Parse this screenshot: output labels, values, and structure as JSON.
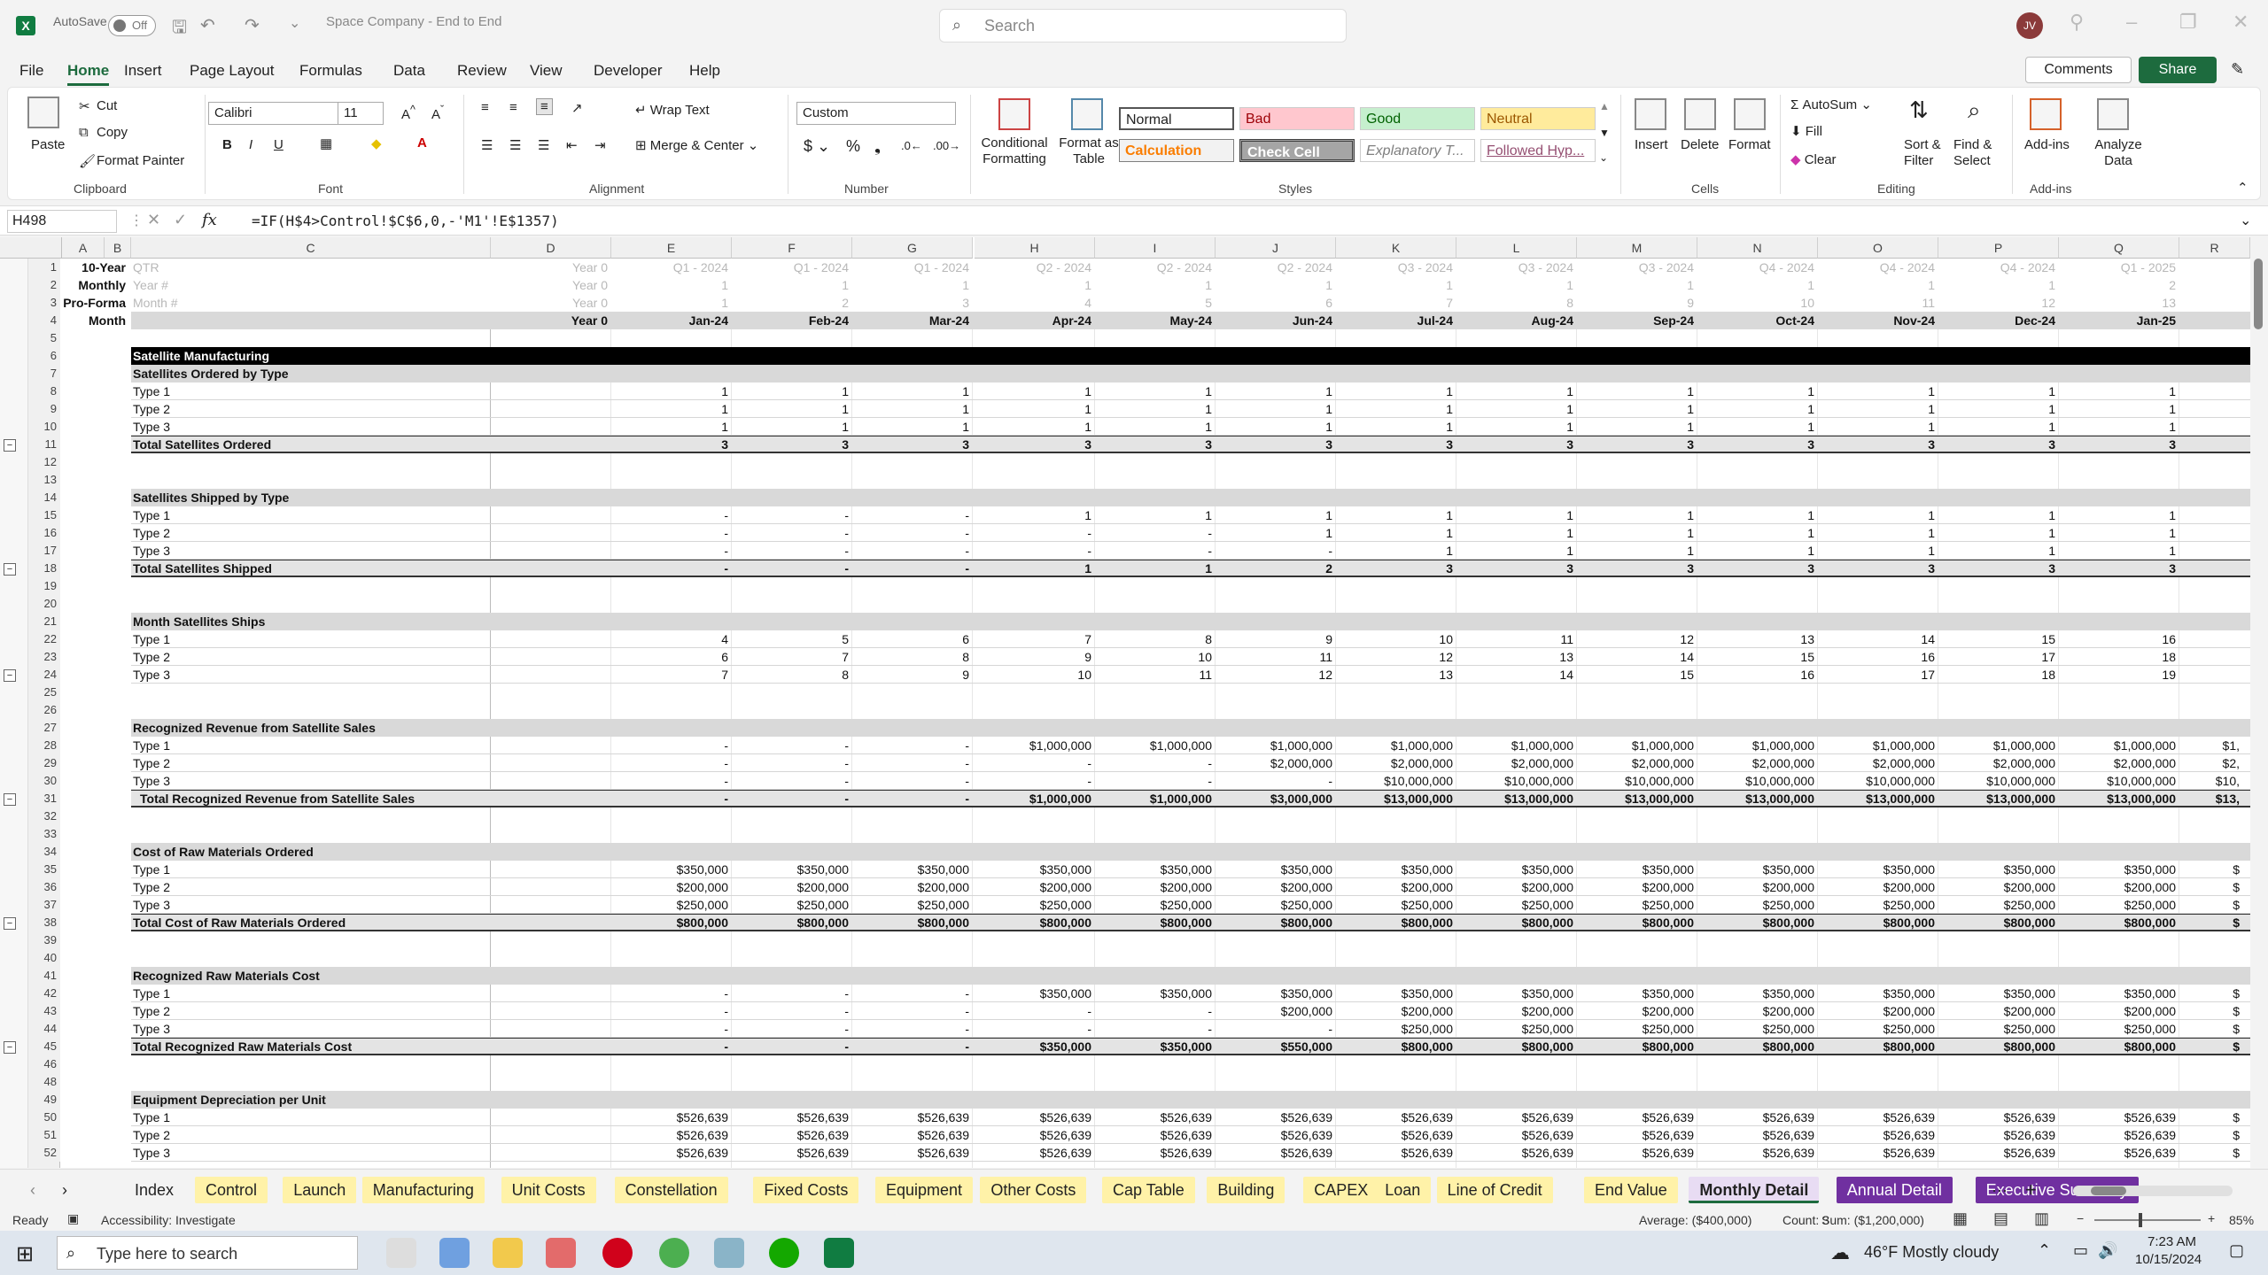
{
  "app": {
    "autosave_label": "AutoSave",
    "autosave_state": "Off",
    "doc_title": "Space Company - End to End",
    "search_placeholder": "Search",
    "avatar": "JV"
  },
  "menu": [
    "File",
    "Home",
    "Insert",
    "Page Layout",
    "Formulas",
    "Data",
    "Review",
    "View",
    "Developer",
    "Help"
  ],
  "menu_active": "Home",
  "comments": "Comments",
  "share": "Share",
  "ribbon": {
    "clipboard": {
      "paste": "Paste",
      "cut": "Cut",
      "copy": "Copy",
      "format_painter": "Format Painter",
      "group": "Clipboard"
    },
    "font": {
      "family": "Calibri",
      "size": "11",
      "group": "Font"
    },
    "alignment": {
      "wrap": "Wrap Text",
      "merge": "Merge & Center",
      "group": "Alignment"
    },
    "number": {
      "format": "Custom",
      "group": "Number"
    },
    "styles": {
      "cond": "Conditional Formatting",
      "fmt_table": "Format as Table",
      "normal": "Normal",
      "bad": "Bad",
      "good": "Good",
      "neutral": "Neutral",
      "calculation": "Calculation",
      "check": "Check Cell",
      "explanatory": "Explanatory T...",
      "followed": "Followed Hyp...",
      "group": "Styles"
    },
    "cells": {
      "insert": "Insert",
      "delete": "Delete",
      "format": "Format",
      "group": "Cells"
    },
    "editing": {
      "autosum": "AutoSum",
      "fill": "Fill",
      "clear": "Clear",
      "sort": "Sort & Filter",
      "find": "Find & Select",
      "group": "Editing"
    },
    "addins": {
      "addins": "Add-ins",
      "analyze": "Analyze Data",
      "group": "Add-ins"
    }
  },
  "namebox": "H498",
  "formula": "=IF(H$4>Control!$C$6,0,-'M1'!E$1357)",
  "columns": [
    "A",
    "B",
    "C",
    "D",
    "E",
    "F",
    "G",
    "H",
    "I",
    "J",
    "K",
    "L",
    "M",
    "N",
    "O",
    "P",
    "Q",
    "R"
  ],
  "header_rows": {
    "row1": {
      "label": "10-Year",
      "sub": "QTR",
      "year0": "Year 0",
      "vals": [
        "Q1 - 2024",
        "Q1 - 2024",
        "Q1 - 2024",
        "Q2 - 2024",
        "Q2 - 2024",
        "Q2 - 2024",
        "Q3 - 2024",
        "Q3 - 2024",
        "Q3 - 2024",
        "Q4 - 2024",
        "Q4 - 2024",
        "Q4 - 2024",
        "Q1 - 2025"
      ]
    },
    "row2": {
      "label": "Monthly",
      "sub": "Year #",
      "year0": "Year 0",
      "vals": [
        "1",
        "1",
        "1",
        "1",
        "1",
        "1",
        "1",
        "1",
        "1",
        "1",
        "1",
        "1",
        "2"
      ]
    },
    "row3": {
      "label": "Pro-Forma",
      "sub": "Month #",
      "year0": "Year 0",
      "vals": [
        "1",
        "2",
        "3",
        "4",
        "5",
        "6",
        "7",
        "8",
        "9",
        "10",
        "11",
        "12",
        "13"
      ]
    },
    "row4": {
      "label": "Month",
      "year0": "Year 0",
      "vals": [
        "Jan-24",
        "Feb-24",
        "Mar-24",
        "Apr-24",
        "May-24",
        "Jun-24",
        "Jul-24",
        "Aug-24",
        "Sep-24",
        "Oct-24",
        "Nov-24",
        "Dec-24",
        "Jan-25"
      ]
    }
  },
  "rows": [
    {
      "r": "5"
    },
    {
      "r": "6",
      "label": "Satellite Manufacturing",
      "kind": "banner"
    },
    {
      "r": "7",
      "label": "Satellites Ordered by Type",
      "kind": "section"
    },
    {
      "r": "8",
      "label": "Type 1",
      "vals": [
        "1",
        "1",
        "1",
        "1",
        "1",
        "1",
        "1",
        "1",
        "1",
        "1",
        "1",
        "1",
        "1"
      ]
    },
    {
      "r": "9",
      "label": "Type 2",
      "vals": [
        "1",
        "1",
        "1",
        "1",
        "1",
        "1",
        "1",
        "1",
        "1",
        "1",
        "1",
        "1",
        "1"
      ]
    },
    {
      "r": "10",
      "label": "Type 3",
      "vals": [
        "1",
        "1",
        "1",
        "1",
        "1",
        "1",
        "1",
        "1",
        "1",
        "1",
        "1",
        "1",
        "1"
      ]
    },
    {
      "r": "11",
      "label": "Total Satellites Ordered",
      "kind": "total",
      "vals": [
        "3",
        "3",
        "3",
        "3",
        "3",
        "3",
        "3",
        "3",
        "3",
        "3",
        "3",
        "3",
        "3"
      ]
    },
    {
      "r": "12"
    },
    {
      "r": "13"
    },
    {
      "r": "14",
      "label": "Satellites Shipped by Type",
      "kind": "section"
    },
    {
      "r": "15",
      "label": "Type 1",
      "vals": [
        "-",
        "-",
        "-",
        "1",
        "1",
        "1",
        "1",
        "1",
        "1",
        "1",
        "1",
        "1",
        "1"
      ]
    },
    {
      "r": "16",
      "label": "Type 2",
      "vals": [
        "-",
        "-",
        "-",
        "-",
        "-",
        "1",
        "1",
        "1",
        "1",
        "1",
        "1",
        "1",
        "1"
      ]
    },
    {
      "r": "17",
      "label": "Type 3",
      "vals": [
        "-",
        "-",
        "-",
        "-",
        "-",
        "-",
        "1",
        "1",
        "1",
        "1",
        "1",
        "1",
        "1"
      ]
    },
    {
      "r": "18",
      "label": "Total Satellites Shipped",
      "kind": "total",
      "vals": [
        "-",
        "-",
        "-",
        "1",
        "1",
        "2",
        "3",
        "3",
        "3",
        "3",
        "3",
        "3",
        "3"
      ]
    },
    {
      "r": "19"
    },
    {
      "r": "20"
    },
    {
      "r": "21",
      "label": "Month Satellites Ships",
      "kind": "section"
    },
    {
      "r": "22",
      "label": "Type 1",
      "vals": [
        "4",
        "5",
        "6",
        "7",
        "8",
        "9",
        "10",
        "11",
        "12",
        "13",
        "14",
        "15",
        "16"
      ]
    },
    {
      "r": "23",
      "label": "Type 2",
      "vals": [
        "6",
        "7",
        "8",
        "9",
        "10",
        "11",
        "12",
        "13",
        "14",
        "15",
        "16",
        "17",
        "18"
      ]
    },
    {
      "r": "24",
      "label": "Type 3",
      "vals": [
        "7",
        "8",
        "9",
        "10",
        "11",
        "12",
        "13",
        "14",
        "15",
        "16",
        "17",
        "18",
        "19"
      ]
    },
    {
      "r": "25"
    },
    {
      "r": "26"
    },
    {
      "r": "27",
      "label": "Recognized Revenue from Satellite Sales",
      "kind": "section"
    },
    {
      "r": "28",
      "label": "Type 1",
      "vals": [
        "-",
        "-",
        "-",
        "$1,000,000",
        "$1,000,000",
        "$1,000,000",
        "$1,000,000",
        "$1,000,000",
        "$1,000,000",
        "$1,000,000",
        "$1,000,000",
        "$1,000,000",
        "$1,000,000"
      ],
      "extra": "$1,"
    },
    {
      "r": "29",
      "label": "Type 2",
      "vals": [
        "-",
        "-",
        "-",
        "-",
        "-",
        "$2,000,000",
        "$2,000,000",
        "$2,000,000",
        "$2,000,000",
        "$2,000,000",
        "$2,000,000",
        "$2,000,000",
        "$2,000,000"
      ],
      "extra": "$2,"
    },
    {
      "r": "30",
      "label": "Type 3",
      "vals": [
        "-",
        "-",
        "-",
        "-",
        "-",
        "-",
        "$10,000,000",
        "$10,000,000",
        "$10,000,000",
        "$10,000,000",
        "$10,000,000",
        "$10,000,000",
        "$10,000,000"
      ],
      "extra": "$10,"
    },
    {
      "r": "31",
      "label": "Total Recognized Revenue from Satellite Sales",
      "kind": "total",
      "indent": true,
      "vals": [
        "-",
        "-",
        "-",
        "$1,000,000",
        "$1,000,000",
        "$3,000,000",
        "$13,000,000",
        "$13,000,000",
        "$13,000,000",
        "$13,000,000",
        "$13,000,000",
        "$13,000,000",
        "$13,000,000"
      ],
      "extra": "$13,"
    },
    {
      "r": "32"
    },
    {
      "r": "33"
    },
    {
      "r": "34",
      "label": "Cost of Raw Materials Ordered",
      "kind": "section"
    },
    {
      "r": "35",
      "label": "Type 1",
      "vals": [
        "$350,000",
        "$350,000",
        "$350,000",
        "$350,000",
        "$350,000",
        "$350,000",
        "$350,000",
        "$350,000",
        "$350,000",
        "$350,000",
        "$350,000",
        "$350,000",
        "$350,000"
      ],
      "extra": "$"
    },
    {
      "r": "36",
      "label": "Type 2",
      "vals": [
        "$200,000",
        "$200,000",
        "$200,000",
        "$200,000",
        "$200,000",
        "$200,000",
        "$200,000",
        "$200,000",
        "$200,000",
        "$200,000",
        "$200,000",
        "$200,000",
        "$200,000"
      ],
      "extra": "$"
    },
    {
      "r": "37",
      "label": "Type 3",
      "vals": [
        "$250,000",
        "$250,000",
        "$250,000",
        "$250,000",
        "$250,000",
        "$250,000",
        "$250,000",
        "$250,000",
        "$250,000",
        "$250,000",
        "$250,000",
        "$250,000",
        "$250,000"
      ],
      "extra": "$"
    },
    {
      "r": "38",
      "label": "Total Cost of Raw Materials Ordered",
      "kind": "total",
      "vals": [
        "$800,000",
        "$800,000",
        "$800,000",
        "$800,000",
        "$800,000",
        "$800,000",
        "$800,000",
        "$800,000",
        "$800,000",
        "$800,000",
        "$800,000",
        "$800,000",
        "$800,000"
      ],
      "extra": "$"
    },
    {
      "r": "39"
    },
    {
      "r": "40"
    },
    {
      "r": "41",
      "label": "Recognized Raw Materials Cost",
      "kind": "section"
    },
    {
      "r": "42",
      "label": "Type 1",
      "vals": [
        "-",
        "-",
        "-",
        "$350,000",
        "$350,000",
        "$350,000",
        "$350,000",
        "$350,000",
        "$350,000",
        "$350,000",
        "$350,000",
        "$350,000",
        "$350,000"
      ],
      "extra": "$"
    },
    {
      "r": "43",
      "label": "Type 2",
      "vals": [
        "-",
        "-",
        "-",
        "-",
        "-",
        "$200,000",
        "$200,000",
        "$200,000",
        "$200,000",
        "$200,000",
        "$200,000",
        "$200,000",
        "$200,000"
      ],
      "extra": "$"
    },
    {
      "r": "44",
      "label": "Type 3",
      "vals": [
        "-",
        "-",
        "-",
        "-",
        "-",
        "-",
        "$250,000",
        "$250,000",
        "$250,000",
        "$250,000",
        "$250,000",
        "$250,000",
        "$250,000"
      ],
      "extra": "$"
    },
    {
      "r": "45",
      "label": "Total Recognized Raw Materials Cost",
      "kind": "total",
      "vals": [
        "-",
        "-",
        "-",
        "$350,000",
        "$350,000",
        "$550,000",
        "$800,000",
        "$800,000",
        "$800,000",
        "$800,000",
        "$800,000",
        "$800,000",
        "$800,000"
      ],
      "extra": "$"
    },
    {
      "r": "46"
    },
    {
      "r": "48"
    },
    {
      "r": "49",
      "label": "Equipment Depreciation per Unit",
      "kind": "section"
    },
    {
      "r": "50",
      "label": "Type 1",
      "vals": [
        "$526,639",
        "$526,639",
        "$526,639",
        "$526,639",
        "$526,639",
        "$526,639",
        "$526,639",
        "$526,639",
        "$526,639",
        "$526,639",
        "$526,639",
        "$526,639",
        "$526,639"
      ],
      "extra": "$"
    },
    {
      "r": "51",
      "label": "Type 2",
      "vals": [
        "$526,639",
        "$526,639",
        "$526,639",
        "$526,639",
        "$526,639",
        "$526,639",
        "$526,639",
        "$526,639",
        "$526,639",
        "$526,639",
        "$526,639",
        "$526,639",
        "$526,639"
      ],
      "extra": "$"
    },
    {
      "r": "52",
      "label": "Type 3",
      "vals": [
        "$526,639",
        "$526,639",
        "$526,639",
        "$526,639",
        "$526,639",
        "$526,639",
        "$526,639",
        "$526,639",
        "$526,639",
        "$526,639",
        "$526,639",
        "$526,639",
        "$526,639"
      ],
      "extra": "$"
    }
  ],
  "sheet_tabs": [
    {
      "name": "Index",
      "color": "#f3f3f3"
    },
    {
      "name": "Control",
      "color": "#fff2a8"
    },
    {
      "name": "Launch",
      "color": "#fff2a8"
    },
    {
      "name": "Manufacturing",
      "color": "#fff2a8"
    },
    {
      "name": "Unit Costs",
      "color": "#fff2a8"
    },
    {
      "name": "Constellation",
      "color": "#fff2a8"
    },
    {
      "name": "Fixed Costs",
      "color": "#fff2a8"
    },
    {
      "name": "Equipment",
      "color": "#fff2a8"
    },
    {
      "name": "Other Costs",
      "color": "#fff2a8"
    },
    {
      "name": "Cap Table",
      "color": "#fff2a8"
    },
    {
      "name": "Building",
      "color": "#fff2a8"
    },
    {
      "name": "CAPEX",
      "color": "#fff2a8"
    },
    {
      "name": "Loan",
      "color": "#fff2a8"
    },
    {
      "name": "Line of Credit",
      "color": "#fff2a8"
    },
    {
      "name": "End Value",
      "color": "#fff2a8"
    },
    {
      "name": "Monthly Detail",
      "color": "#e3d6f0",
      "active": true
    },
    {
      "name": "Annual Detail",
      "color": "#7030a0"
    },
    {
      "name": "Executive Summary",
      "color": "#7030a0"
    }
  ],
  "status": {
    "ready": "Ready",
    "accessibility": "Accessibility: Investigate",
    "average": "Average: ($400,000)",
    "count": "Count: 3",
    "sum": "Sum: ($1,200,000)",
    "zoom": "85%"
  },
  "taskbar": {
    "search": "Type here to search",
    "weather": "46°F  Mostly cloudy",
    "time": "7:23 AM",
    "date": "10/15/2024"
  }
}
